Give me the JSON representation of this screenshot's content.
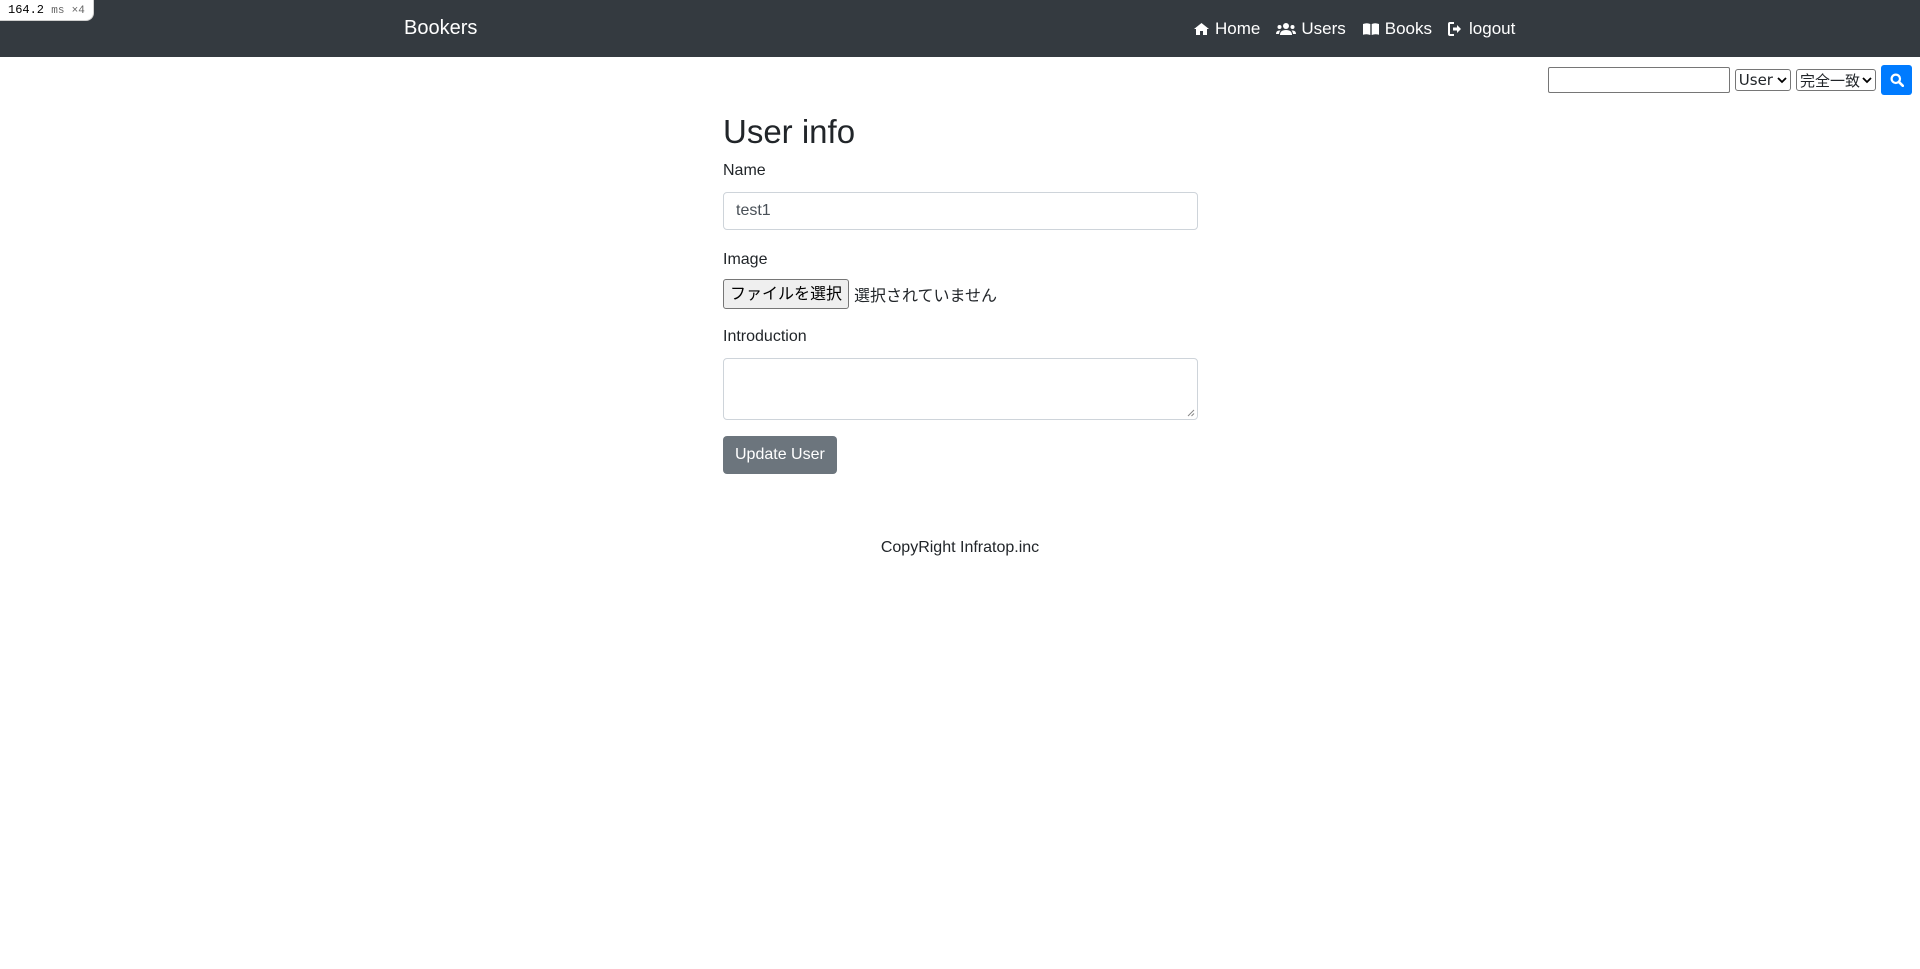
{
  "perf_badge": {
    "value": "164.2",
    "unit": "ms",
    "multiplier": "×4"
  },
  "navbar": {
    "brand": "Bookers",
    "links": [
      {
        "label": "Home",
        "icon": "home-icon"
      },
      {
        "label": "Users",
        "icon": "users-icon"
      },
      {
        "label": "Books",
        "icon": "book-open-icon"
      },
      {
        "label": "logout",
        "icon": "sign-out-icon"
      }
    ]
  },
  "search": {
    "input_value": "",
    "model_select": "User",
    "method_select": "完全一致",
    "button_icon": "search-icon"
  },
  "form": {
    "title": "User info",
    "name_label": "Name",
    "name_value": "test1",
    "image_label": "Image",
    "file_button": "ファイルを選択",
    "file_status": "選択されていません",
    "introduction_label": "Introduction",
    "introduction_value": "",
    "submit_label": "Update User"
  },
  "footer": {
    "text": "CopyRight Infratop.inc"
  },
  "colors": {
    "navbar_bg": "#343a40",
    "search_button": "#007bff",
    "submit_button": "#6c757d"
  }
}
